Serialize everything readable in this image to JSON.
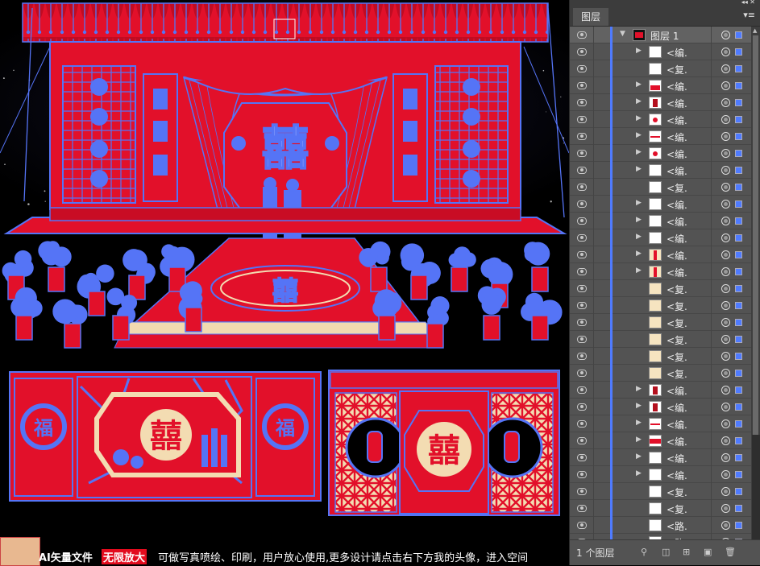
{
  "panel": {
    "tab_label": "图层",
    "menu_icon": "panel-menu-icon",
    "collapse_icon": "collapse-double-arrow-icon",
    "layer_count": "1 个图层",
    "layers": [
      {
        "name": "图层 1",
        "thumb": "dark",
        "expand": true,
        "top": true
      },
      {
        "name": "<编.",
        "thumb": "white",
        "expand": true
      },
      {
        "name": "<复.",
        "thumb": "white",
        "expand": false
      },
      {
        "name": "<编.",
        "thumb": "red-scene",
        "expand": true
      },
      {
        "name": "<编.",
        "thumb": "red-figure",
        "expand": true
      },
      {
        "name": "<编.",
        "thumb": "red-dot",
        "expand": true
      },
      {
        "name": "<编.",
        "thumb": "red-line",
        "expand": true
      },
      {
        "name": "<编.",
        "thumb": "red-dot",
        "expand": true
      },
      {
        "name": "<编.",
        "thumb": "white",
        "expand": true
      },
      {
        "name": "<复.",
        "thumb": "white",
        "expand": false
      },
      {
        "name": "<编.",
        "thumb": "white",
        "expand": true
      },
      {
        "name": "<编.",
        "thumb": "white",
        "expand": true
      },
      {
        "name": "<编.",
        "thumb": "white",
        "expand": true
      },
      {
        "name": "<编.",
        "thumb": "cream-bar",
        "expand": true
      },
      {
        "name": "<编.",
        "thumb": "cream-bar",
        "expand": true
      },
      {
        "name": "<复.",
        "thumb": "cream",
        "expand": false
      },
      {
        "name": "<复.",
        "thumb": "cream",
        "expand": false
      },
      {
        "name": "<复.",
        "thumb": "cream",
        "expand": false
      },
      {
        "name": "<复.",
        "thumb": "cream",
        "expand": false
      },
      {
        "name": "<复.",
        "thumb": "cream",
        "expand": false
      },
      {
        "name": "<复.",
        "thumb": "cream",
        "expand": false
      },
      {
        "name": "<编.",
        "thumb": "red-figure",
        "expand": true
      },
      {
        "name": "<编.",
        "thumb": "red-figure",
        "expand": true
      },
      {
        "name": "<编.",
        "thumb": "red-line",
        "expand": true
      },
      {
        "name": "<编.",
        "thumb": "red-bar",
        "expand": true
      },
      {
        "name": "<编.",
        "thumb": "white",
        "expand": true
      },
      {
        "name": "<编.",
        "thumb": "white",
        "expand": true
      },
      {
        "name": "<复.",
        "thumb": "white",
        "expand": false
      },
      {
        "name": "<复.",
        "thumb": "white",
        "expand": false
      },
      {
        "name": "<路.",
        "thumb": "white",
        "expand": false
      },
      {
        "name": "<路.",
        "thumb": "white",
        "expand": false
      },
      {
        "name": "<路.",
        "thumb": "white",
        "expand": false
      }
    ],
    "footer_icons": [
      "search-icon",
      "clipping-mask-icon",
      "new-sublayer-icon",
      "new-layer-icon",
      "delete-layer-icon"
    ]
  },
  "canvas": {
    "stage_text_top": "囍",
    "floor_text": "囍",
    "panel_symbol_left": "囍",
    "panel_symbol_right": "囍",
    "side_medallion_text": "福"
  },
  "banner": {
    "part1": "AI矢量文件",
    "part2": "无限放大",
    "part3": "可做写真喷绘、印刷，用户放心使用,更多设计请点击右下方我的头像，进入空间"
  },
  "colors": {
    "stage_red": "#e2102a",
    "selection_blue": "#5574f6",
    "cream": "#f6e2bd",
    "panel_bg": "#535353"
  }
}
